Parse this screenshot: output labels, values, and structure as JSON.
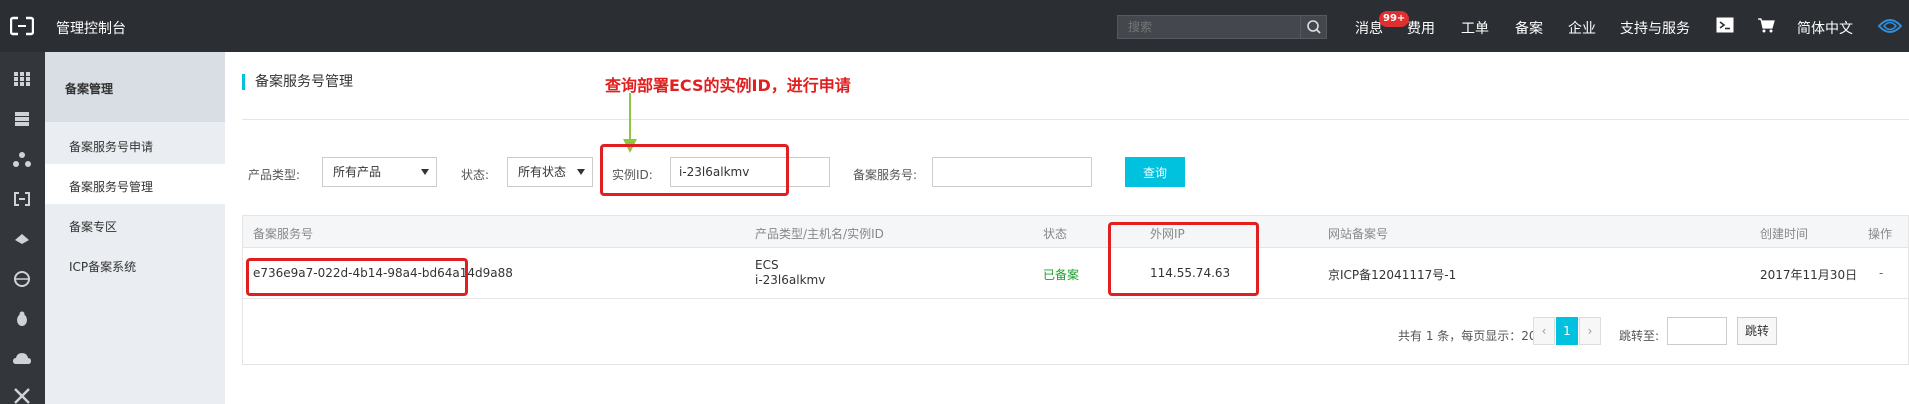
{
  "topbar": {
    "title": "管理控制台",
    "search_placeholder": "搜索",
    "nav": [
      "消息",
      "费用",
      "工单",
      "备案",
      "企业",
      "支持与服务"
    ],
    "badge": "99+",
    "language": "简体中文"
  },
  "sidebar": {
    "header": "备案管理",
    "items": [
      "备案服务号申请",
      "备案服务号管理",
      "备案专区",
      "ICP备案系统"
    ]
  },
  "page": {
    "title": "备案服务号管理",
    "annotation": "查询部署ECS的实例ID，进行申请"
  },
  "filters": {
    "product_type_label": "产品类型:",
    "product_type_value": "所有产品",
    "status_label": "状态:",
    "status_value": "所有状态",
    "instance_id_label": "实例ID:",
    "instance_id_value": "i-23l6alkmv",
    "service_no_label": "备案服务号:",
    "service_no_value": "",
    "query_label": "查询"
  },
  "table": {
    "headers": [
      "备案服务号",
      "产品类型/主机名/实例ID",
      "状态",
      "外网IP",
      "网站备案号",
      "创建时间",
      "操作"
    ],
    "rows": [
      {
        "service_no": "e736e9a7-022d-4b14-98a4-bd64a14d9a88",
        "product": "ECS",
        "instance": "i-23l6alkmv",
        "status": "已备案",
        "ip": "114.55.74.63",
        "icp": "京ICP备12041117号-1",
        "created": "2017年11月30日",
        "op": "-"
      }
    ]
  },
  "pagination": {
    "summary": "共有 1 条，每页显示：20条",
    "prev": "‹",
    "current": "1",
    "next": "›",
    "jump_label": "跳转至:",
    "go_label": "跳转"
  },
  "colors": {
    "accent": "#00c1de",
    "annotation": "#e02020",
    "topbar": "#2b2e33",
    "success": "#1e9f2b"
  }
}
